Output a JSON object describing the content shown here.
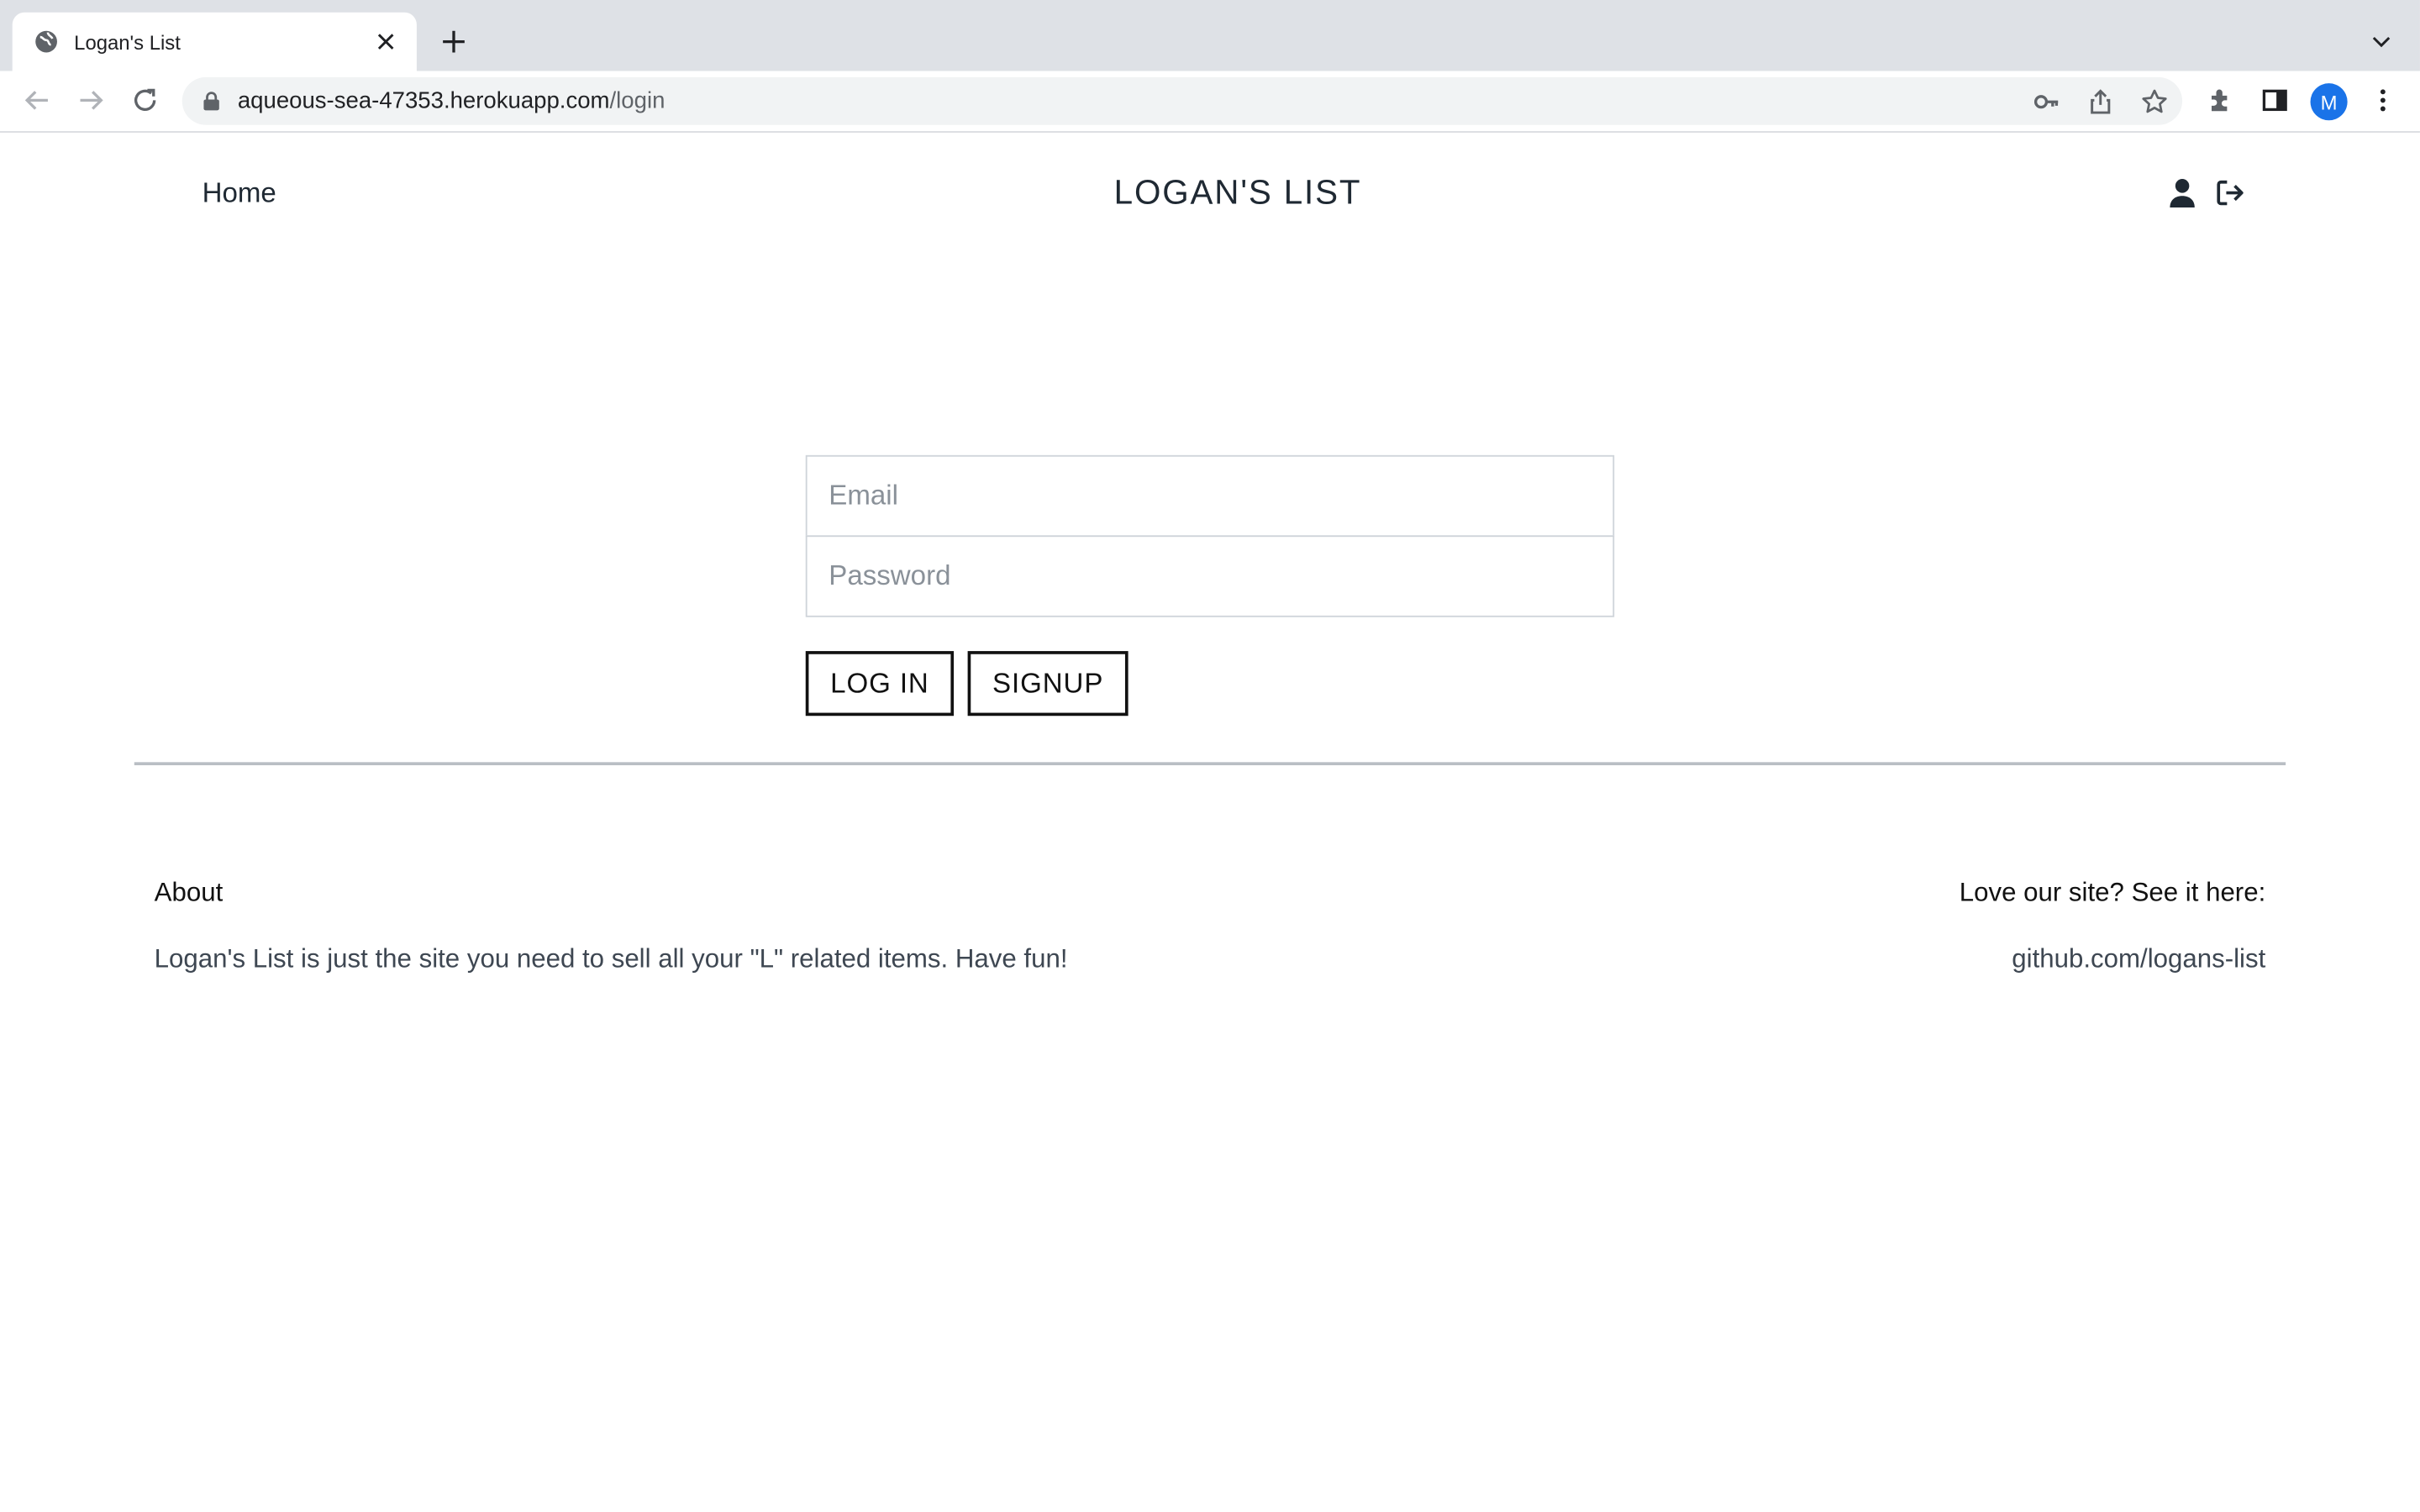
{
  "browser": {
    "tab": {
      "title": "Logan's List",
      "favicon": "globe-icon",
      "close_icon": "close-icon"
    },
    "new_tab_icon": "plus-icon",
    "tab_menu_icon": "chevron-down-icon",
    "url": {
      "host": "aqueous-sea-47353.herokuapp.com",
      "path": "/login"
    },
    "profile_initial": "M",
    "accent": "#1a73e8"
  },
  "nav": {
    "home_label": "Home",
    "site_title": "LOGAN'S LIST",
    "icons": [
      "user-icon",
      "logout-icon"
    ]
  },
  "login_form": {
    "email_placeholder": "Email",
    "password_placeholder": "Password",
    "login_label": "LOG IN",
    "signup_label": "SIGNUP"
  },
  "footer": {
    "about_heading": "About",
    "about_text": "Logan's List is just the site you need to sell all your \"L\" related items. Have fun!",
    "love_heading": "Love our site? See it here:",
    "repo_link": "github.com/logans-list"
  }
}
